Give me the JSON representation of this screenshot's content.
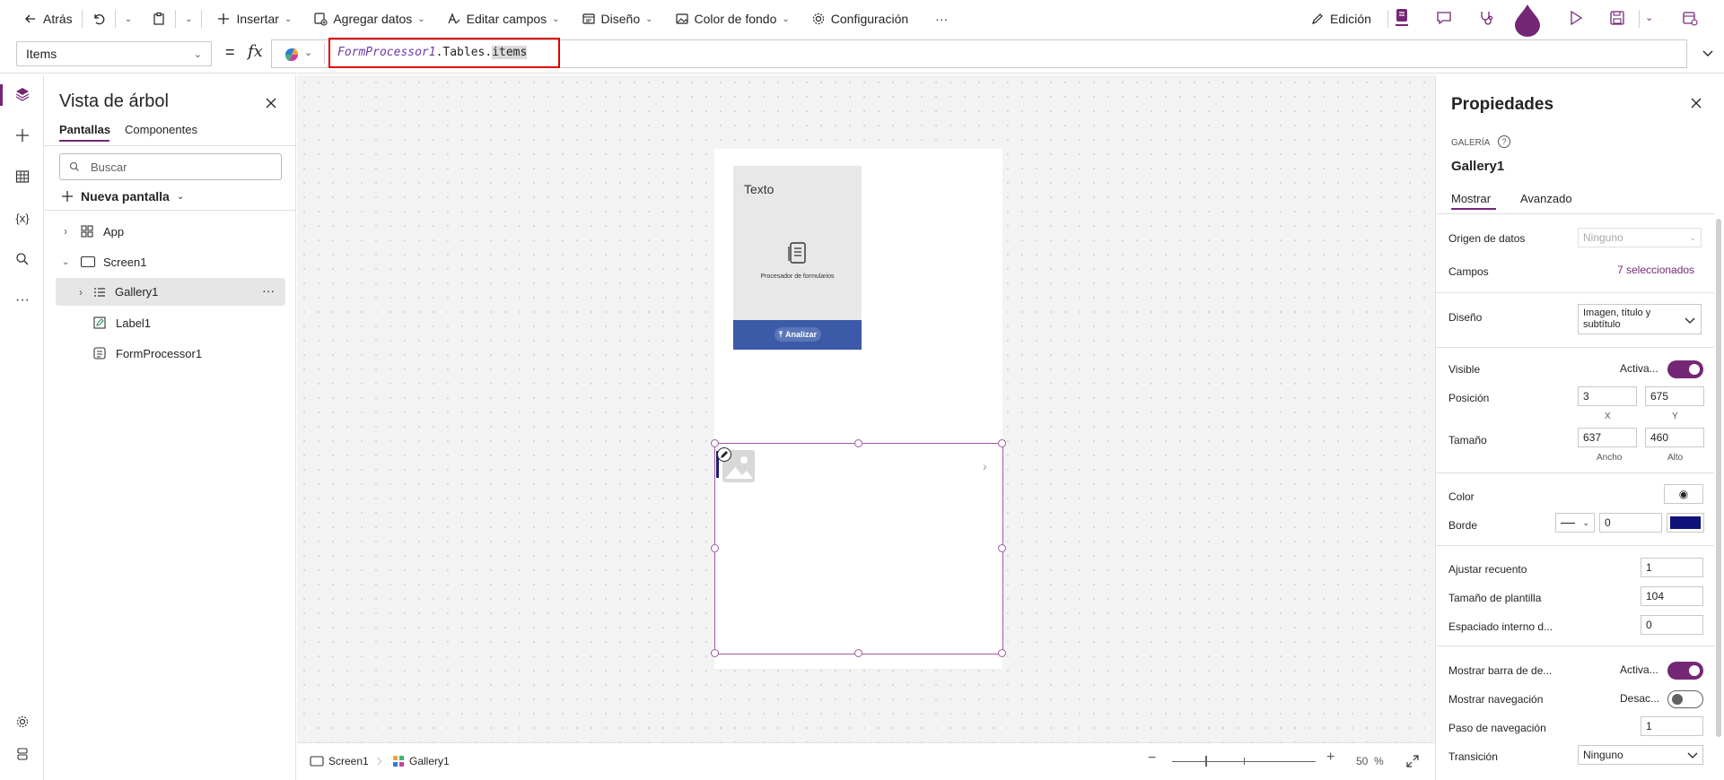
{
  "commandbar": {
    "back": "Atrás",
    "insert": "Insertar",
    "add_data": "Agregar datos",
    "edit_fields": "Editar campos",
    "design": "Diseño",
    "background_color": "Color de fondo",
    "settings": "Configuración",
    "more": "···",
    "edit_mode": "Edición"
  },
  "formulabar": {
    "property": "Items",
    "equals": "=",
    "fx": "fx",
    "formula_object": "FormProcessor1",
    "formula_rest": ".Tables.",
    "formula_selected": "items"
  },
  "tree": {
    "title": "Vista de árbol",
    "tabs": [
      "Pantallas",
      "Componentes"
    ],
    "search_placeholder": "Buscar",
    "new_screen": "Nueva pantalla",
    "items": [
      "App",
      "Screen1",
      "Gallery1",
      "Label1",
      "FormProcessor1"
    ],
    "item_more": "···"
  },
  "canvas": {
    "text_label": "Texto",
    "form_processor_caption": "Procesador de formularios",
    "analyze_button": "Analizar"
  },
  "footer": {
    "breadcrumb": [
      "Screen1",
      "Gallery1"
    ],
    "zoom_value": "50",
    "zoom_unit": "%",
    "zoom_minus": "−",
    "zoom_plus": "+"
  },
  "properties": {
    "title": "Propiedades",
    "type_label": "GALERÍA",
    "control_name": "Gallery1",
    "tabs": [
      "Mostrar",
      "Avanzado"
    ],
    "data_source_label": "Origen de datos",
    "data_source_value": "Ninguno",
    "fields_label": "Campos",
    "fields_value": "7 seleccionados",
    "layout_label": "Diseño",
    "layout_value": "Imagen, título y subtítulo",
    "visible_label": "Visible",
    "visible_value": "Activa...",
    "position_label": "Posición",
    "position_x": "3",
    "position_y": "675",
    "x_caption": "X",
    "y_caption": "Y",
    "size_label": "Tamaño",
    "width": "637",
    "height": "460",
    "width_caption": "Ancho",
    "height_caption": "Alto",
    "color_label": "Color",
    "border_label": "Borde",
    "border_value": "0",
    "border_color": "#0f1279",
    "wrap_count_label": "Ajustar recuento",
    "wrap_count_value": "1",
    "template_size_label": "Tamaño de plantilla",
    "template_size_value": "104",
    "template_padding_label": "Espaciado interno d...",
    "template_padding_value": "0",
    "show_scrollbar_label": "Mostrar barra de de...",
    "show_scrollbar_value": "Activa...",
    "show_nav_label": "Mostrar navegación",
    "show_nav_value": "Desac...",
    "nav_step_label": "Paso de navegación",
    "nav_step_value": "1",
    "transition_label": "Transición",
    "transition_value": "Ninguno"
  },
  "colors": {
    "accent": "#742774",
    "analyze_bar": "#3b5ba9",
    "selection": "#a259a2"
  }
}
